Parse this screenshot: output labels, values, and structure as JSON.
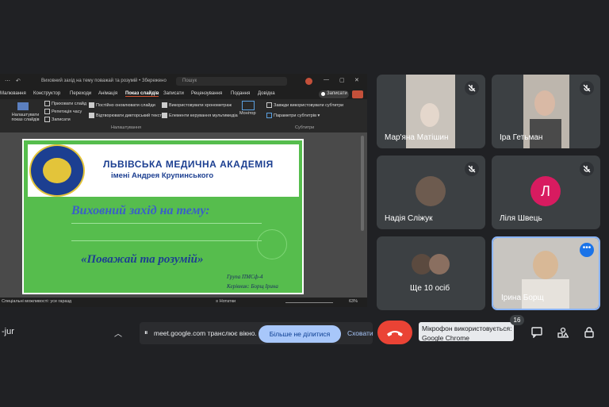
{
  "presentation": {
    "window_title": "Виховний захід на тему поважай та розумій • Збережено",
    "search_placeholder": "Пошук",
    "menu": [
      "Малювання",
      "Конструктор",
      "Переходи",
      "Анімація",
      "Показ слайдів",
      "Записати",
      "Рецензування",
      "Подання",
      "Довідка"
    ],
    "active_menu": "Показ слайдів",
    "record_button": "Записати",
    "ribbon": {
      "rehearse": "Налаштувати показ слайдів",
      "hide_slide": "Приховати слайд",
      "rehearse_timings": "Репетиція часу",
      "record": "Записати",
      "keep_updated": "Постійно оновлювати слайди",
      "play_narrations": "Відтворювати дикторський текст",
      "use_timings": "Використовувати хронометраж",
      "media_controls": "Елементи керування мультимедіа",
      "monitor": "Монітор",
      "group_setup": "Налаштування",
      "always_subtitles": "Завжди використовувати субтитри",
      "subtitle_settings": "Параметри субтитрів",
      "group_subtitles": "Субтитри"
    },
    "slide": {
      "academy_line1": "ЛЬВІВСЬКА МЕДИЧНА АКАДЕМІЯ",
      "academy_line2": "імені Андрея Крупинського",
      "topic": "Виховний захід на тему:",
      "quote": "«Поважай та розумій»",
      "group": "Група ПМСф-4",
      "leader": "Керівник: Борщ Ірина"
    },
    "status": {
      "accessibility": "Спеціальні можливості: усе гаразд",
      "notes": "Нотатки",
      "zoom": "63%"
    }
  },
  "participants": [
    {
      "name": "Мар'яна Матішин",
      "muted": true
    },
    {
      "name": "Іра Гетьман",
      "muted": true
    },
    {
      "name": "Надія Сліжук",
      "muted": true
    },
    {
      "name": "Ліля Швець",
      "muted": true,
      "initial": "Л"
    },
    {
      "name": "Ще 10 осіб",
      "muted": false
    },
    {
      "name": "Ірина Борщ",
      "muted": false
    }
  ],
  "bottom_bar": {
    "meeting_code": "-jur",
    "share_notice": "meet.google.com транслює вікно.",
    "stop_sharing": "Більше не ділитися",
    "hide": "Сховати",
    "mic_notice_line1": "Мікрофон використовується:",
    "mic_notice_line2": "Google Chrome",
    "participants_count": "16"
  },
  "colors": {
    "accent": "#8ab4f8",
    "end_call": "#ea4335",
    "slide_green": "#56bd4d",
    "academy_blue": "#1c3f91"
  }
}
